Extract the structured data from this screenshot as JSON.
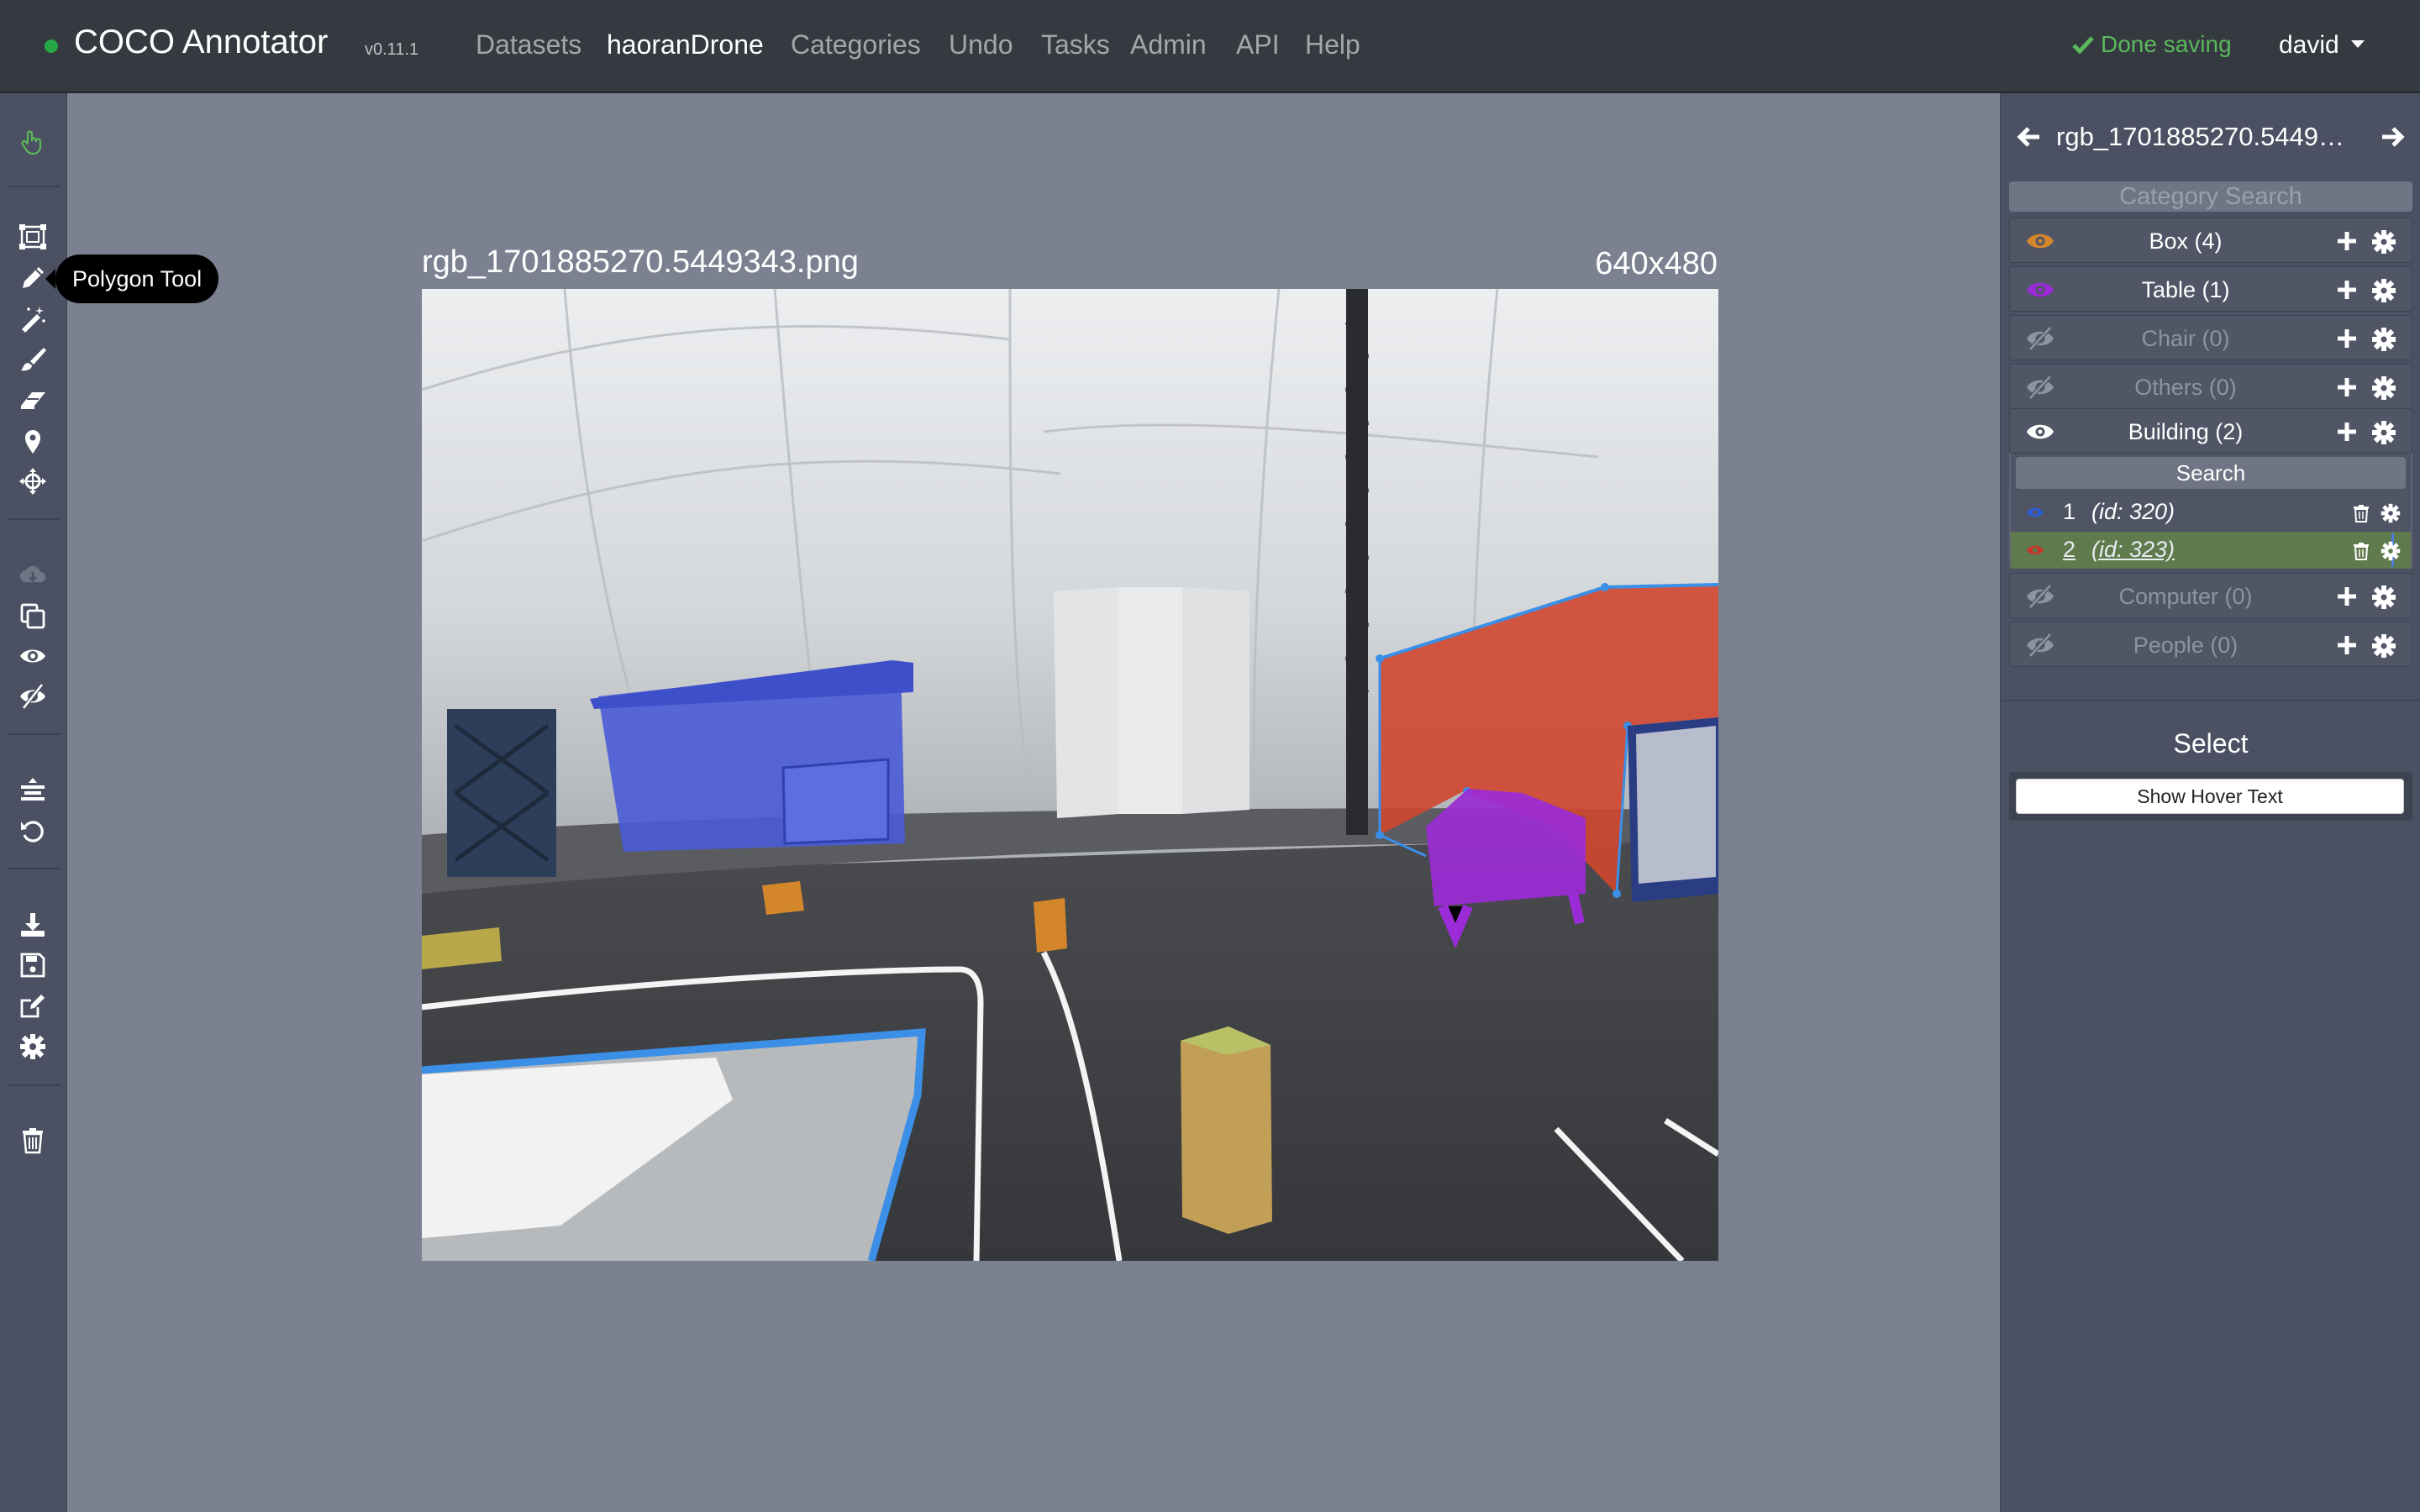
{
  "header": {
    "brand": "COCO Annotator",
    "version": "v0.11.1",
    "nav": [
      "Datasets",
      "haoranDrone",
      "Categories",
      "Undo",
      "Tasks",
      "Admin",
      "API",
      "Help"
    ],
    "active_nav": "haoranDrone",
    "status": "Done saving",
    "user": "david"
  },
  "toolbar": {
    "tooltip": "Polygon Tool",
    "tools": [
      "select-icon",
      "bbox-icon",
      "polygon-icon",
      "magic-wand-icon",
      "brush-icon",
      "eraser-icon",
      "keypoint-icon",
      "dextr-icon",
      "cloud-download-icon",
      "copy-icon",
      "show-all-icon",
      "hide-all-icon",
      "center-image-icon",
      "undo-icon",
      "download-icon",
      "save-icon",
      "edit-icon",
      "settings-icon",
      "delete-icon"
    ]
  },
  "image": {
    "filename": "rgb_1701885270.5449343.png",
    "dimensions": "640x480"
  },
  "panel": {
    "title": "rgb_1701885270.5449343.png",
    "category_search_placeholder": "Category Search",
    "categories": [
      {
        "label": "Box (4)",
        "color": "#d4862a",
        "visible": true
      },
      {
        "label": "Table (1)",
        "color": "#9b2bd6",
        "visible": true
      },
      {
        "label": "Chair (0)",
        "color": "#8d93a1",
        "visible": false
      },
      {
        "label": "Others (0)",
        "color": "#8d93a1",
        "visible": false
      },
      {
        "label": "Building (2)",
        "color": "#ffffff",
        "visible": true
      },
      {
        "label": "Computer (0)",
        "color": "#8d93a1",
        "visible": false
      },
      {
        "label": "People (0)",
        "color": "#8d93a1",
        "visible": false
      }
    ],
    "annotation_search": "Search",
    "annotations": [
      {
        "num": "1",
        "id_text": "(id: 320)",
        "color": "#2d5bd6"
      },
      {
        "num": "2",
        "id_text": "(id: 323)",
        "color": "#c9342a"
      }
    ],
    "select_title": "Select",
    "hover_button": "Show Hover Text"
  }
}
